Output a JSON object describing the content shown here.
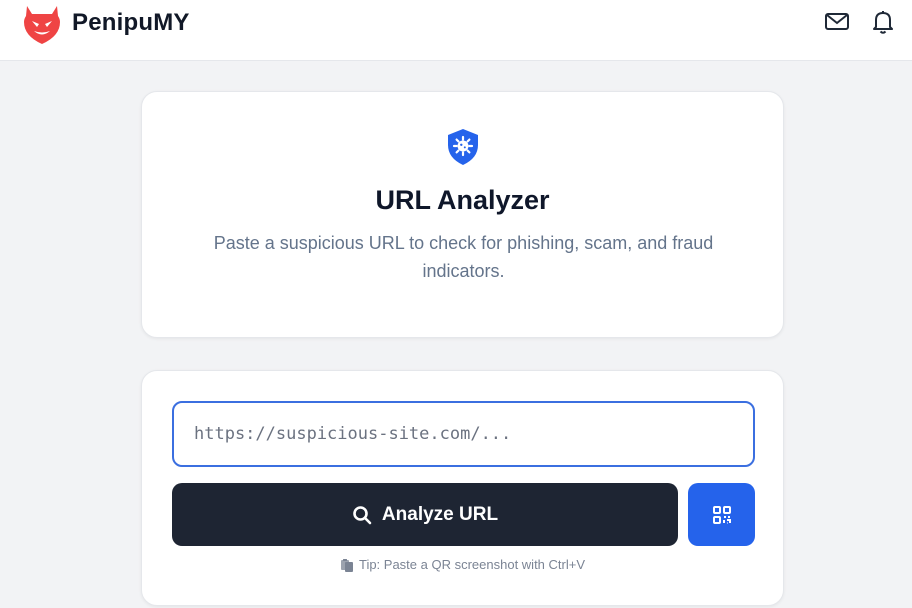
{
  "app": {
    "brand": "PenipuMY",
    "logo_icon": "devil-shield-icon",
    "brand_color": "#ef4444"
  },
  "header": {
    "icons": [
      "mail-icon",
      "bell-icon"
    ]
  },
  "hero": {
    "icon": "shield-virus-icon",
    "title": "URL Analyzer",
    "subtitle": "Paste a suspicious URL to check for phishing, scam, and fraud indicators."
  },
  "form": {
    "url_placeholder": "https://suspicious-site.com/...",
    "url_value": "",
    "analyze_label": "Analyze URL",
    "analyze_icon": "search-icon",
    "qr_icon": "qr-code-icon",
    "tip_icon": "paste-icon",
    "tip_text": "Tip: Paste a QR screenshot with Ctrl+V"
  },
  "colors": {
    "accent": "#2563eb",
    "dark_button": "#1e2533",
    "input_border": "#3b6fe0"
  }
}
